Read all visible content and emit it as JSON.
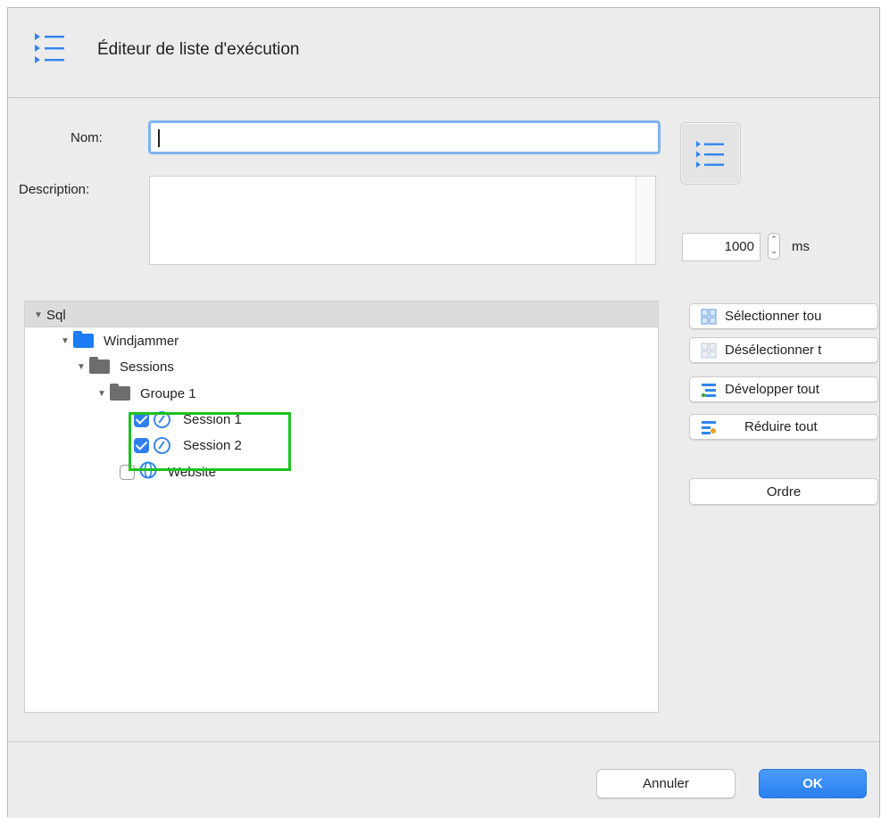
{
  "window": {
    "title": "Éditeur de liste d'exécution"
  },
  "form": {
    "name_label": "Nom:",
    "name_value": "",
    "description_label": "Description:",
    "description_value": "",
    "delay_value": "1000",
    "delay_unit": "ms"
  },
  "tree": {
    "root": "Sql",
    "items": [
      {
        "label": "Windjammer",
        "type": "folder-blue",
        "expanded": true
      },
      {
        "label": "Sessions",
        "type": "folder-gray",
        "expanded": true
      },
      {
        "label": "Groupe 1",
        "type": "folder-gray",
        "expanded": true
      },
      {
        "label": "Session 1",
        "type": "session",
        "checked": true
      },
      {
        "label": "Session 2",
        "type": "session",
        "checked": true
      },
      {
        "label": "Website",
        "type": "website",
        "checked": false
      }
    ]
  },
  "side_buttons": {
    "select_all": "Sélectionner tou",
    "deselect_all": "Désélectionner t",
    "expand_all": "Développer tout",
    "collapse_all": "Réduire tout",
    "order": "Ordre"
  },
  "footer": {
    "cancel": "Annuler",
    "ok": "OK"
  },
  "colors": {
    "accent": "#2e7ff1",
    "highlight": "#1dc11d",
    "ok_button": "#3b8ef6"
  },
  "icons": {
    "title": "list-icon",
    "list_button": "list-icon",
    "folder": "folder-icon",
    "session": "session-icon",
    "website": "globe-icon"
  }
}
